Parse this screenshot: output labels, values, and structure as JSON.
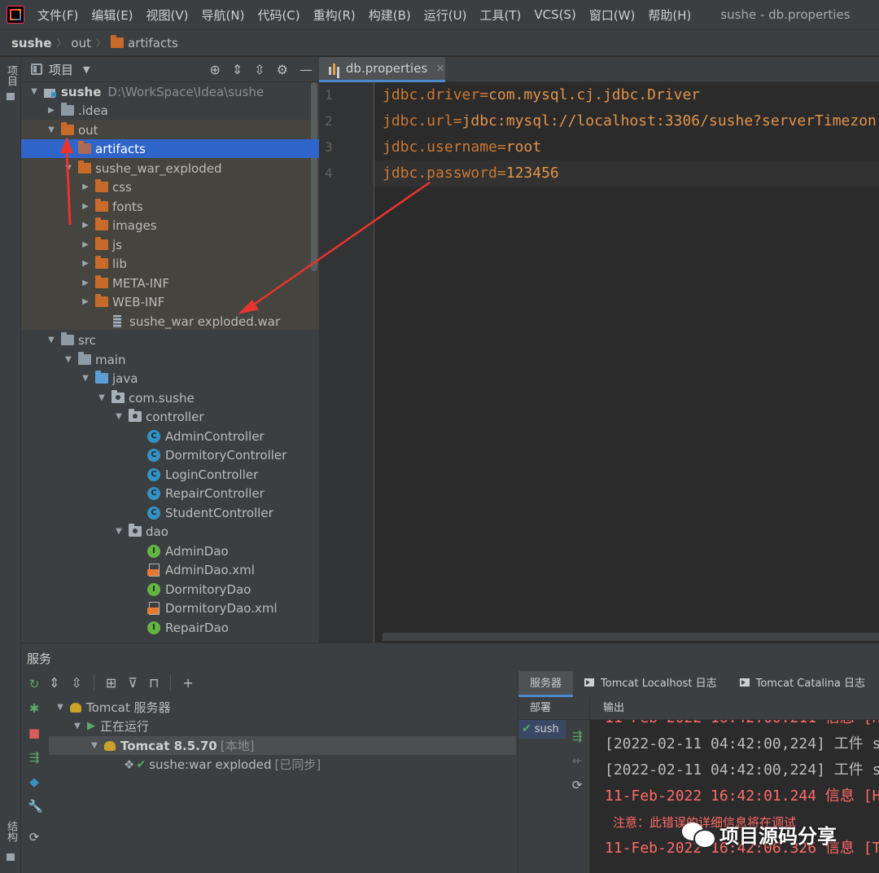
{
  "menu": {
    "items": [
      "文件(F)",
      "编辑(E)",
      "视图(V)",
      "导航(N)",
      "代码(C)",
      "重构(R)",
      "构建(B)",
      "运行(U)",
      "工具(T)",
      "VCS(S)",
      "窗口(W)",
      "帮助(H)"
    ],
    "window_title": "sushe - db.properties"
  },
  "breadcrumb": {
    "project": "sushe",
    "dir": "out",
    "folder": "artifacts"
  },
  "left_strip": {
    "project_label": "项目",
    "structure_label": "结构"
  },
  "project_panel": {
    "title": "项目",
    "tree": [
      {
        "label": "sushe",
        "extra": "D:\\WorkSpace\\Idea\\sushe",
        "icon": "module-icon",
        "arrow": "▼"
      },
      {
        "label": ".idea",
        "icon": "folder-gray",
        "arrow": "▶"
      },
      {
        "label": "out",
        "icon": "folder-orange",
        "arrow": "▼"
      },
      {
        "label": "artifacts",
        "icon": "folder-orange",
        "arrow": ""
      },
      {
        "label": "sushe_war_exploded",
        "icon": "folder-orange",
        "arrow": "▼"
      },
      {
        "label": "css",
        "icon": "folder-orange",
        "arrow": "▶"
      },
      {
        "label": "fonts",
        "icon": "folder-orange",
        "arrow": "▶"
      },
      {
        "label": "images",
        "icon": "folder-orange",
        "arrow": "▶"
      },
      {
        "label": "js",
        "icon": "folder-orange",
        "arrow": "▶"
      },
      {
        "label": "lib",
        "icon": "folder-orange",
        "arrow": "▶"
      },
      {
        "label": "META-INF",
        "icon": "folder-orange",
        "arrow": "▶"
      },
      {
        "label": "WEB-INF",
        "icon": "folder-orange",
        "arrow": "▶"
      },
      {
        "label": "sushe_war exploded.war",
        "icon": "war-icon",
        "arrow": ""
      },
      {
        "label": "src",
        "icon": "folder-gray",
        "arrow": "▼"
      },
      {
        "label": "main",
        "icon": "folder-gray",
        "arrow": "▼"
      },
      {
        "label": "java",
        "icon": "folder-src",
        "arrow": "▼"
      },
      {
        "label": "com.sushe",
        "icon": "package-icon",
        "arrow": "▼"
      },
      {
        "label": "controller",
        "icon": "package-icon",
        "arrow": "▼"
      },
      {
        "label": "AdminController",
        "icon": "class-icon",
        "arrow": ""
      },
      {
        "label": "DormitoryController",
        "icon": "class-icon",
        "arrow": ""
      },
      {
        "label": "LoginController",
        "icon": "class-icon",
        "arrow": ""
      },
      {
        "label": "RepairController",
        "icon": "class-icon",
        "arrow": ""
      },
      {
        "label": "StudentController",
        "icon": "class-icon",
        "arrow": ""
      },
      {
        "label": "dao",
        "icon": "package-icon",
        "arrow": "▼"
      },
      {
        "label": "AdminDao",
        "icon": "interface-icon",
        "arrow": ""
      },
      {
        "label": "AdminDao.xml",
        "icon": "xml-icon",
        "arrow": ""
      },
      {
        "label": "DormitoryDao",
        "icon": "interface-icon",
        "arrow": ""
      },
      {
        "label": "DormitoryDao.xml",
        "icon": "xml-icon",
        "arrow": ""
      },
      {
        "label": "RepairDao",
        "icon": "interface-icon",
        "arrow": ""
      }
    ]
  },
  "editor": {
    "tab_label": "db.properties",
    "lines": [
      {
        "num": "1",
        "key": "jdbc.driver",
        "value": "com.mysql.cj.jdbc.Driver"
      },
      {
        "num": "2",
        "key": "jdbc.url",
        "value": "jdbc:mysql://localhost:3306/sushe?serverTimezon"
      },
      {
        "num": "3",
        "key": "jdbc.username",
        "value": "root"
      },
      {
        "num": "4",
        "key": "jdbc.password",
        "value": "123456"
      }
    ]
  },
  "services": {
    "title": "服务",
    "tree": {
      "server": "Tomcat 服务器",
      "running": "正在运行",
      "instance": "Tomcat 8.5.70",
      "instance_tag": "[本地]",
      "artifact": "sushe:war exploded",
      "artifact_tag": "[已同步]"
    },
    "tabs": [
      "服务器",
      "Tomcat Localhost 日志",
      "Tomcat Catalina 日志"
    ],
    "deploy_header": "部署",
    "deploy_item": "sush",
    "output_header": "输出",
    "log_lines": [
      {
        "text": "11-Feb-2022 16:42:00.211 信息 [H",
        "color": "red"
      },
      {
        "text": "[2022-02-11 04:42:00,224] 工件 s",
        "color": "white"
      },
      {
        "text": "[2022-02-11 04:42:00,224] 工件 s",
        "color": "white"
      },
      {
        "text": "11-Feb-2022 16:42:01.244 信息 [H",
        "color": "red"
      },
      {
        "text": "注意：此错误的详细信息将在调试",
        "color": "note"
      },
      {
        "text": "11-Feb-2022 16:42:06.326 信息 [T",
        "color": "red"
      }
    ]
  },
  "watermark": {
    "text": "项目源码分享"
  }
}
